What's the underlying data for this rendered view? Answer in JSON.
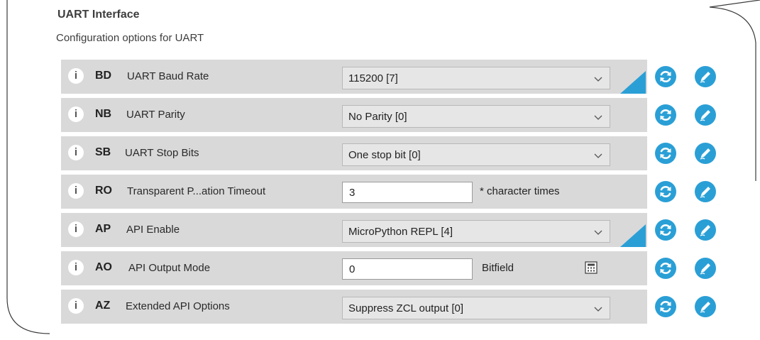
{
  "header": {
    "title": "UART Interface",
    "subtitle": "Configuration options for UART"
  },
  "rows": [
    {
      "code": "BD",
      "label": "UART Baud Rate",
      "control": "select",
      "value": "115200 [7]",
      "modified": true
    },
    {
      "code": "NB",
      "label": "UART Parity",
      "control": "select",
      "value": "No Parity [0]",
      "modified": false
    },
    {
      "code": "SB",
      "label": "UART Stop Bits",
      "control": "select",
      "value": "One stop bit [0]",
      "modified": false
    },
    {
      "code": "RO",
      "label": "Transparent P...ation Timeout",
      "control": "input",
      "value": "3",
      "suffix": "* character times",
      "modified": false
    },
    {
      "code": "AP",
      "label": "API Enable",
      "control": "select",
      "value": "MicroPython REPL [4]",
      "modified": true
    },
    {
      "code": "AO",
      "label": "API Output Mode",
      "control": "input",
      "value": "0",
      "suffix": "Bitfield",
      "modified": false
    },
    {
      "code": "AZ",
      "label": "Extended API Options",
      "control": "select",
      "value": "Suppress ZCL output [0]",
      "modified": false
    }
  ],
  "icons": {
    "info": "info-icon",
    "dropdown": "chevron-down-icon",
    "read": "refresh-icon",
    "write": "pencil-icon",
    "bitfield": "calculator-icon",
    "modified": "modified-corner-icon"
  },
  "colors": {
    "row_bg": "#d9d9d9",
    "accent": "#2a9fd6",
    "text": "#222222"
  },
  "info_glyph": "i"
}
